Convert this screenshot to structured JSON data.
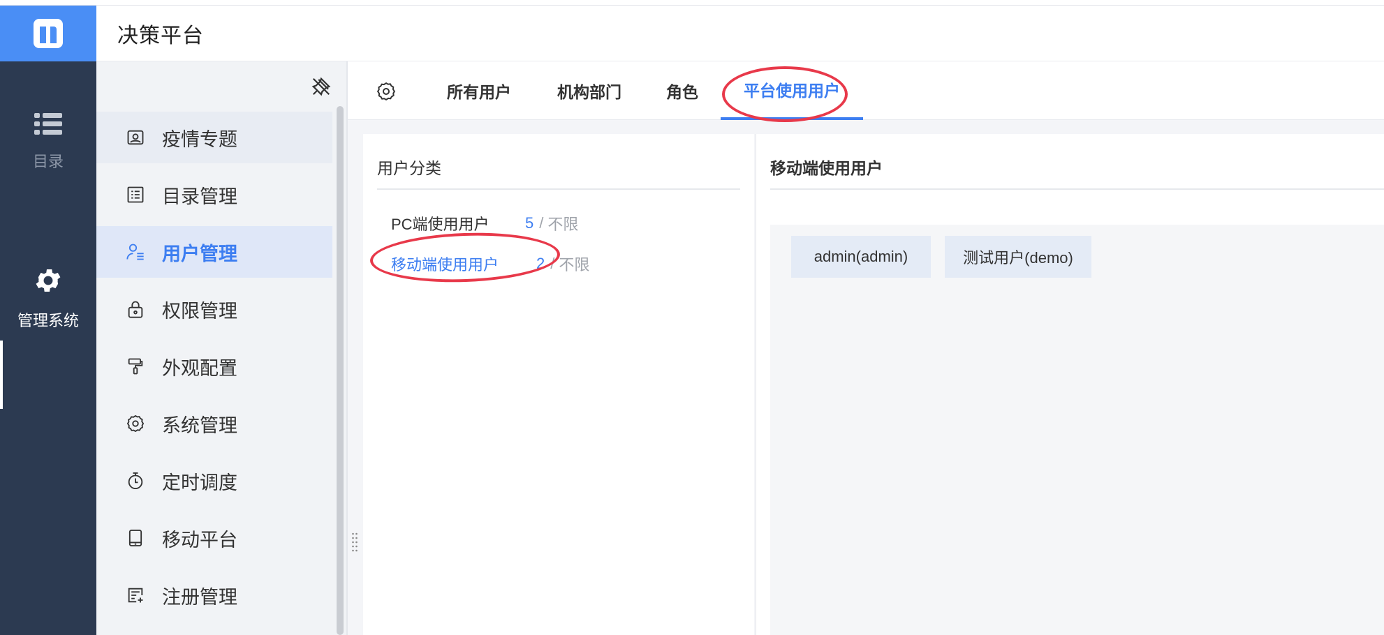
{
  "app": {
    "title": "决策平台"
  },
  "rail": {
    "items": [
      {
        "label": "目录",
        "icon": "list-icon"
      },
      {
        "label": "管理系统",
        "icon": "gear-icon"
      }
    ]
  },
  "sidebar": {
    "items": [
      {
        "label": "疫情专题",
        "icon": "monitor-icon"
      },
      {
        "label": "目录管理",
        "icon": "list-doc-icon"
      },
      {
        "label": "用户管理",
        "icon": "user-list-icon"
      },
      {
        "label": "权限管理",
        "icon": "lock-icon"
      },
      {
        "label": "外观配置",
        "icon": "paint-roller-icon"
      },
      {
        "label": "系统管理",
        "icon": "gear-icon"
      },
      {
        "label": "定时调度",
        "icon": "stopwatch-icon"
      },
      {
        "label": "移动平台",
        "icon": "tablet-icon"
      },
      {
        "label": "注册管理",
        "icon": "register-icon"
      }
    ]
  },
  "tabs": [
    {
      "label": "所有用户"
    },
    {
      "label": "机构部门"
    },
    {
      "label": "角色"
    },
    {
      "label": "平台使用用户"
    }
  ],
  "left_panel": {
    "title": "用户分类",
    "categories": [
      {
        "name": "PC端使用用户",
        "count": "5",
        "sep": "/",
        "limit": "不限"
      },
      {
        "name": "移动端使用用户",
        "count": "2",
        "sep": "/",
        "limit": "不限"
      }
    ]
  },
  "right_panel": {
    "title": "移动端使用用户",
    "users": [
      "admin(admin)",
      "测试用户(demo)"
    ]
  },
  "colors": {
    "accent": "#3d7ef1",
    "logo_bg": "#4a8ef5",
    "rail_bg": "#2c3a51",
    "annotation": "#e8394a"
  }
}
